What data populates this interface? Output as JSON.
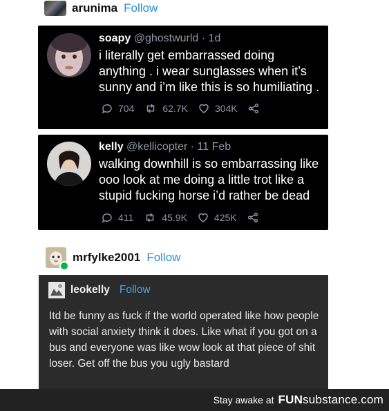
{
  "top_user": {
    "name": "arunima",
    "follow": "Follow"
  },
  "tweets": [
    {
      "name": "soapy",
      "handle": "@ghostwurld · 1d",
      "text": "i literally get embarrassed doing anything . i wear sunglasses when it’s sunny and i’m like this is so humiliating .",
      "replies": "704",
      "retweets": "62.7K",
      "likes": "304K"
    },
    {
      "name": "kelly",
      "handle": "@kellicopter · 11 Feb",
      "text": "walking downhill is so embarrassing like ooo look at me doing a little trot like a stupid fucking horse i’d rather be dead",
      "replies": "411",
      "retweets": "45.9K",
      "likes": "425K"
    }
  ],
  "second_user": {
    "name": "mrfylke2001",
    "follow": "Follow"
  },
  "reblog": {
    "name": "leokelly",
    "follow": "Follow",
    "text": "Itd be funny as fuck if the world operated  like how people with social anxiety  think it does. Like what if you got on a bus and everyone was like wow look at that piece of shit loser. Get  off the bus you ugly bastard"
  },
  "footer": {
    "tagline": "Stay awake at",
    "brand_a": "FUN",
    "brand_b": "substance",
    "brand_c": ".com"
  },
  "icons": [
    "reply-icon",
    "retweet-icon",
    "like-icon",
    "share-icon"
  ]
}
